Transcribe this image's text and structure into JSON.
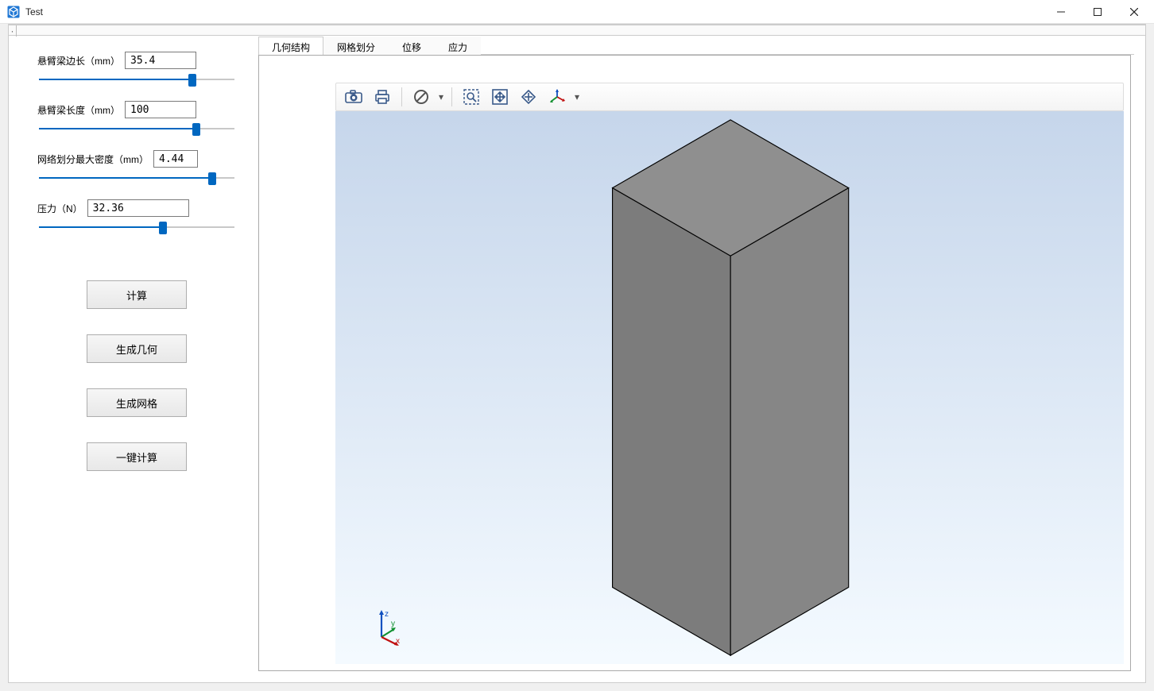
{
  "window": {
    "title": "Test"
  },
  "params": {
    "edge": {
      "label": "悬臂梁边长（mm）",
      "value": "35.4",
      "percent": 78
    },
    "length": {
      "label": "悬臂梁长度（mm）",
      "value": "100",
      "percent": 80
    },
    "mesh": {
      "label": "网络划分最大密度（mm）",
      "value": "4.44",
      "percent": 88
    },
    "force": {
      "label": "压力（N）",
      "value": "32.36",
      "percent": 63
    }
  },
  "buttons": {
    "compute": "计算",
    "genGeom": "生成几何",
    "genMesh": "生成网格",
    "oneKey": "一键计算"
  },
  "tabs": {
    "geom": "几何结构",
    "mesh": "网格划分",
    "disp": "位移",
    "stress": "应力"
  },
  "axis": {
    "z": "z",
    "y": "y",
    "x": "x"
  }
}
